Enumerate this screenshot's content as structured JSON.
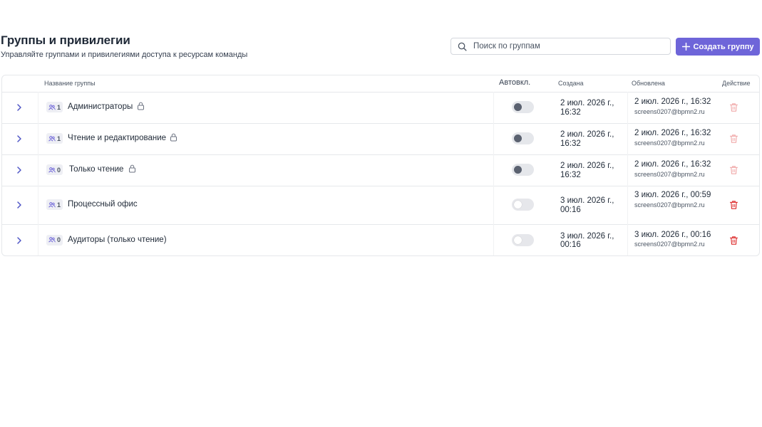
{
  "header": {
    "title": "Группы и привилегии",
    "subtitle": "Управляйте группами и привилегиями доступа к ресурсам команды"
  },
  "search": {
    "placeholder": "Поиск по группам",
    "value": ""
  },
  "create_button": {
    "label": "Создать группу",
    "icon": "plus-icon"
  },
  "table": {
    "columns": {
      "name": "Название группы",
      "auto": "Автовкл.",
      "created": "Создана",
      "updated": "Обновлена",
      "action": "Действие"
    },
    "rows": [
      {
        "count": "1",
        "name": "Администраторы",
        "locked": true,
        "auto_enabled": false,
        "toggle_disabled": true,
        "created": "2 июл. 2026 г., 16:32",
        "updated": "2 июл. 2026 г., 16:32",
        "updated_by": "screens0207@bpmn2.ru",
        "delete_enabled": false
      },
      {
        "count": "1",
        "name": "Чтение и редактирование",
        "locked": true,
        "auto_enabled": false,
        "toggle_disabled": true,
        "created": "2 июл. 2026 г., 16:32",
        "updated": "2 июл. 2026 г., 16:32",
        "updated_by": "screens0207@bpmn2.ru",
        "delete_enabled": false
      },
      {
        "count": "0",
        "name": "Только чтение",
        "locked": true,
        "auto_enabled": false,
        "toggle_disabled": true,
        "created": "2 июл. 2026 г., 16:32",
        "updated": "2 июл. 2026 г., 16:32",
        "updated_by": "screens0207@bpmn2.ru",
        "delete_enabled": false
      },
      {
        "count": "1",
        "name": "Процессный офис",
        "locked": false,
        "auto_enabled": false,
        "toggle_disabled": false,
        "created": "3 июл. 2026 г., 00:16",
        "updated": "3 июл. 2026 г., 00:59",
        "updated_by": "screens0207@bpmn2.ru",
        "delete_enabled": true
      },
      {
        "count": "0",
        "name": "Аудиторы (только чтение)",
        "locked": false,
        "auto_enabled": false,
        "toggle_disabled": false,
        "created": "3 июл. 2026 г., 00:16",
        "updated": "3 июл. 2026 г., 00:16",
        "updated_by": "screens0207@bpmn2.ru",
        "delete_enabled": true
      }
    ]
  },
  "colors": {
    "accent": "#6e65d9",
    "chevron": "#4f56c6",
    "delete_active": "#dc2626",
    "delete_disabled": "#f0a8a8",
    "toggle_knob_disabled": "#5b6270"
  }
}
